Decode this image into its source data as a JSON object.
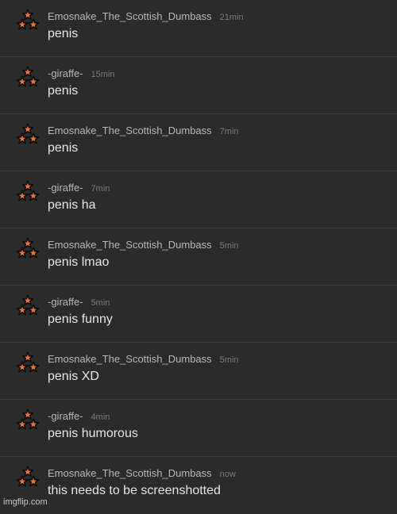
{
  "messages": [
    {
      "author": "Emosnake_The_Scottish_Dumbass",
      "time": "21min",
      "text": "penis",
      "avatar_icon": "star-triangle-icon"
    },
    {
      "author": "-giraffe-",
      "time": "15min",
      "text": "penis",
      "avatar_icon": "star-triangle-icon"
    },
    {
      "author": "Emosnake_The_Scottish_Dumbass",
      "time": "7min",
      "text": "penis",
      "avatar_icon": "star-triangle-icon"
    },
    {
      "author": "-giraffe-",
      "time": "7min",
      "text": "penis ha",
      "avatar_icon": "star-triangle-icon"
    },
    {
      "author": "Emosnake_The_Scottish_Dumbass",
      "time": "5min",
      "text": "penis lmao",
      "avatar_icon": "star-triangle-icon"
    },
    {
      "author": "-giraffe-",
      "time": "5min",
      "text": "penis funny",
      "avatar_icon": "star-triangle-icon"
    },
    {
      "author": "Emosnake_The_Scottish_Dumbass",
      "time": "5min",
      "text": "penis XD",
      "avatar_icon": "star-triangle-icon"
    },
    {
      "author": "-giraffe-",
      "time": "4min",
      "text": "penis humorous",
      "avatar_icon": "star-triangle-icon"
    },
    {
      "author": "Emosnake_The_Scottish_Dumbass",
      "time": "now",
      "text": "this needs to be screenshotted",
      "avatar_icon": "star-triangle-icon"
    }
  ],
  "watermark": "imgflip.com",
  "colors": {
    "background": "#2b2b2b",
    "author": "#b9b9b9",
    "timestamp": "#7c7c7c",
    "message_text": "#e6e6e6",
    "avatar_star": "#e8743b"
  }
}
